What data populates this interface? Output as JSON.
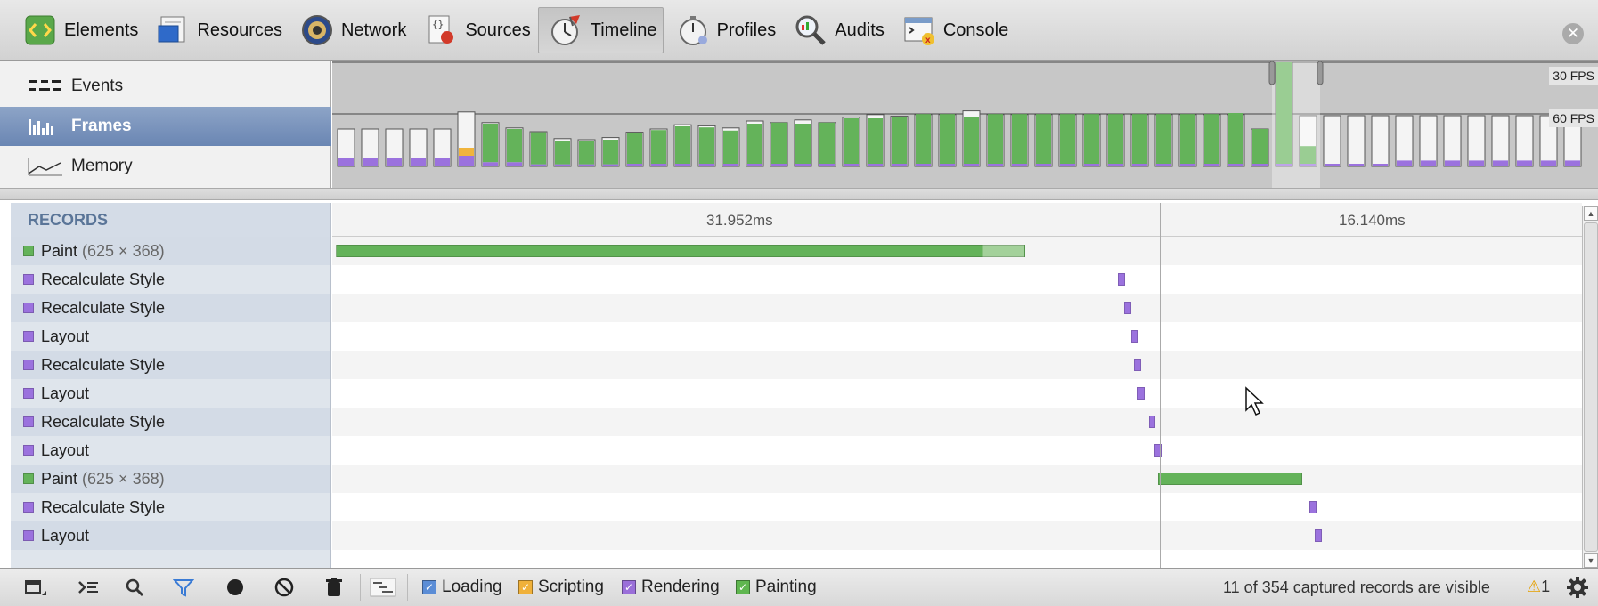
{
  "toolbar": {
    "tabs": [
      {
        "label": "Elements",
        "icon": "elements-icon",
        "active": false
      },
      {
        "label": "Resources",
        "icon": "resources-icon",
        "active": false
      },
      {
        "label": "Network",
        "icon": "network-icon",
        "active": false
      },
      {
        "label": "Sources",
        "icon": "sources-icon",
        "active": false
      },
      {
        "label": "Timeline",
        "icon": "timeline-icon",
        "active": true
      },
      {
        "label": "Profiles",
        "icon": "profiles-icon",
        "active": false
      },
      {
        "label": "Audits",
        "icon": "audits-icon",
        "active": false
      },
      {
        "label": "Console",
        "icon": "console-icon",
        "active": false
      }
    ],
    "close_icon": "close-icon"
  },
  "overview": {
    "items": [
      {
        "label": "Events",
        "icon": "events-icon",
        "selected": false
      },
      {
        "label": "Frames",
        "icon": "frames-icon",
        "selected": true
      },
      {
        "label": "Memory",
        "icon": "memory-icon",
        "selected": false
      }
    ],
    "fps_labels": [
      "30 FPS",
      "60 FPS"
    ],
    "frames": [
      {
        "r": 0.15,
        "p": 0,
        "s": 0,
        "g": 0.7
      },
      {
        "r": 0.15,
        "p": 0,
        "s": 0,
        "g": 0.7
      },
      {
        "r": 0.15,
        "p": 0,
        "s": 0,
        "g": 0.7
      },
      {
        "r": 0.15,
        "p": 0,
        "s": 0,
        "g": 0.7
      },
      {
        "r": 0.15,
        "p": 0,
        "s": 0,
        "g": 0.7
      },
      {
        "r": 0.2,
        "p": 0,
        "s": 0.15,
        "g": 1.02
      },
      {
        "r": 0.08,
        "p": 0.72,
        "s": 0,
        "g": 0.82
      },
      {
        "r": 0.08,
        "p": 0.62,
        "s": 0,
        "g": 0.72
      },
      {
        "r": 0.04,
        "p": 0.6,
        "s": 0,
        "g": 0.65
      },
      {
        "r": 0.04,
        "p": 0.43,
        "s": 0,
        "g": 0.52
      },
      {
        "r": 0.04,
        "p": 0.43,
        "s": 0,
        "g": 0.5
      },
      {
        "r": 0.04,
        "p": 0.46,
        "s": 0,
        "g": 0.54
      },
      {
        "r": 0.05,
        "p": 0.58,
        "s": 0,
        "g": 0.64
      },
      {
        "r": 0.05,
        "p": 0.63,
        "s": 0,
        "g": 0.7
      },
      {
        "r": 0.05,
        "p": 0.7,
        "s": 0,
        "g": 0.78
      },
      {
        "r": 0.05,
        "p": 0.68,
        "s": 0,
        "g": 0.76
      },
      {
        "r": 0.05,
        "p": 0.62,
        "s": 0,
        "g": 0.72
      },
      {
        "r": 0.05,
        "p": 0.75,
        "s": 0,
        "g": 0.85
      },
      {
        "r": 0.05,
        "p": 0.77,
        "s": 0,
        "g": 0.82
      },
      {
        "r": 0.05,
        "p": 0.75,
        "s": 0,
        "g": 0.87
      },
      {
        "r": 0.05,
        "p": 0.77,
        "s": 0,
        "g": 0.82
      },
      {
        "r": 0.05,
        "p": 0.85,
        "s": 0,
        "g": 0.92
      },
      {
        "r": 0.05,
        "p": 0.85,
        "s": 0,
        "g": 0.97
      },
      {
        "r": 0.05,
        "p": 0.87,
        "s": 0,
        "g": 0.94
      },
      {
        "r": 0.05,
        "p": 0.93,
        "s": 0,
        "g": 0.97
      },
      {
        "r": 0.05,
        "p": 0.93,
        "s": 0,
        "g": 0.97
      },
      {
        "r": 0.05,
        "p": 0.88,
        "s": 0,
        "g": 1.04
      },
      {
        "r": 0.05,
        "p": 0.93,
        "s": 0,
        "g": 0.97
      },
      {
        "r": 0.05,
        "p": 0.93,
        "s": 0,
        "g": 0.97
      },
      {
        "r": 0.05,
        "p": 0.93,
        "s": 0,
        "g": 0.97
      },
      {
        "r": 0.05,
        "p": 0.93,
        "s": 0,
        "g": 0.97
      },
      {
        "r": 0.05,
        "p": 0.93,
        "s": 0,
        "g": 0.97
      },
      {
        "r": 0.05,
        "p": 0.93,
        "s": 0,
        "g": 0.97
      },
      {
        "r": 0.05,
        "p": 0.93,
        "s": 0,
        "g": 0.97
      },
      {
        "r": 0.05,
        "p": 0.93,
        "s": 0,
        "g": 0.97
      },
      {
        "r": 0.05,
        "p": 0.93,
        "s": 0,
        "g": 0.97
      },
      {
        "r": 0.05,
        "p": 0.93,
        "s": 0,
        "g": 0.97
      },
      {
        "r": 0.05,
        "p": 0.95,
        "s": 0,
        "g": 0.97
      },
      {
        "r": 0.05,
        "p": 0.65,
        "s": 0,
        "g": 0.7
      },
      {
        "r": 0.05,
        "p": 1.9,
        "s": 0,
        "g": 1.95
      },
      {
        "r": 0.05,
        "p": 0.33,
        "s": 0,
        "g": 0.95
      },
      {
        "r": 0.05,
        "p": 0,
        "s": 0,
        "g": 0.95
      },
      {
        "r": 0.05,
        "p": 0,
        "s": 0,
        "g": 0.95
      },
      {
        "r": 0.05,
        "p": 0,
        "s": 0,
        "g": 0.95
      },
      {
        "r": 0.11,
        "p": 0,
        "s": 0,
        "g": 0.95
      },
      {
        "r": 0.11,
        "p": 0,
        "s": 0,
        "g": 0.95
      },
      {
        "r": 0.11,
        "p": 0,
        "s": 0,
        "g": 0.95
      },
      {
        "r": 0.11,
        "p": 0,
        "s": 0,
        "g": 0.95
      },
      {
        "r": 0.11,
        "p": 0,
        "s": 0,
        "g": 0.95
      },
      {
        "r": 0.11,
        "p": 0,
        "s": 0,
        "g": 0.95
      },
      {
        "r": 0.11,
        "p": 0,
        "s": 0,
        "g": 0.95
      },
      {
        "r": 0.11,
        "p": 0,
        "s": 0,
        "g": 0.95
      }
    ]
  },
  "records": {
    "title": "RECORDS",
    "time_labels": [
      "31.952ms",
      "16.140ms"
    ],
    "rows": [
      {
        "name": "Paint",
        "dims": "(625 × 368)",
        "type": "painting"
      },
      {
        "name": "Recalculate Style",
        "dims": "",
        "type": "rendering"
      },
      {
        "name": "Recalculate Style",
        "dims": "",
        "type": "rendering"
      },
      {
        "name": "Layout",
        "dims": "",
        "type": "rendering"
      },
      {
        "name": "Recalculate Style",
        "dims": "",
        "type": "rendering"
      },
      {
        "name": "Layout",
        "dims": "",
        "type": "rendering"
      },
      {
        "name": "Recalculate Style",
        "dims": "",
        "type": "rendering"
      },
      {
        "name": "Layout",
        "dims": "",
        "type": "rendering"
      },
      {
        "name": "Paint",
        "dims": "(625 × 368)",
        "type": "painting"
      },
      {
        "name": "Recalculate Style",
        "dims": "",
        "type": "rendering"
      },
      {
        "name": "Layout",
        "dims": "",
        "type": "rendering"
      },
      {
        "name": "",
        "dims": "",
        "type": "empty"
      }
    ]
  },
  "statusbar": {
    "buttons": [
      "dock-icon",
      "console-prompt-icon",
      "search-icon",
      "filter-icon",
      "record-icon",
      "clear-icon",
      "garbage-collect-icon",
      "glue-records-icon"
    ],
    "filters": [
      {
        "label": "Loading",
        "color": "#5b8dd6",
        "checked": true
      },
      {
        "label": "Scripting",
        "color": "#f0b13a",
        "checked": true
      },
      {
        "label": "Rendering",
        "color": "#9a6fd9",
        "checked": true
      },
      {
        "label": "Painting",
        "color": "#5fb64f",
        "checked": true
      }
    ],
    "status": "11 of 354 captured records are visible",
    "warning_count": "1",
    "settings_icon": "settings-gear-icon"
  },
  "colors": {
    "painting": "#64b35a",
    "rendering": "#9b72de",
    "scripting": "#f0b43c",
    "selection": "#6a86b3"
  }
}
